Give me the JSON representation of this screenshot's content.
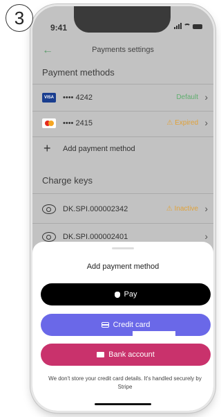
{
  "step_number": "3",
  "status_bar": {
    "time": "9:41"
  },
  "nav": {
    "back_icon": "arrow-left-icon",
    "title": "Payments settings"
  },
  "payment_methods": {
    "header": "Payment methods",
    "items": [
      {
        "brand": "VISA",
        "number": "•••• 4242",
        "status": "Default",
        "status_color": "#5fae6e"
      },
      {
        "brand": "mastercard",
        "number": "•••• 2415",
        "status": "Expired",
        "status_color": "#e0a23a",
        "warning_icon": "⚠"
      }
    ],
    "add_label": "Add payment method"
  },
  "charge_keys": {
    "header": "Charge keys",
    "items": [
      {
        "name": "DK.SPI.000002342",
        "status": "Inactive",
        "status_color": "#e0a23a",
        "warning_icon": "⚠"
      },
      {
        "name": "DK.SPI.000002401"
      }
    ]
  },
  "sheet": {
    "title": "Add payment method",
    "apple_pay_label": "Pay",
    "credit_card_label": "Credit card",
    "bank_account_label": "Bank account",
    "footnote": "We don't store your credit card details. It's handled securely by Stripe"
  },
  "colors": {
    "apple_pay": "#000000",
    "credit_card": "#6a68e8",
    "bank_account": "#c9326c"
  }
}
